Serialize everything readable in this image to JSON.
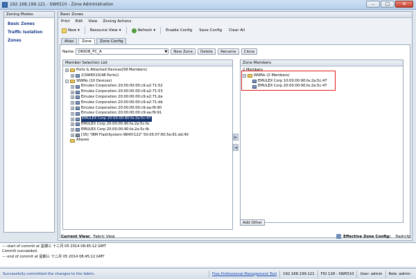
{
  "window": {
    "title": "192.168.199.121 - SW6510 - Zone Administration",
    "min_label": "–",
    "max_label": "□",
    "close_label": "✕"
  },
  "left": {
    "header": "Zoning Modes",
    "items": [
      {
        "label": "Basic Zones"
      },
      {
        "label": "Traffic Isolation Zones"
      }
    ]
  },
  "main": {
    "header": "Basic Zones",
    "menu": [
      "Print",
      "Edit",
      "View",
      "Zoning Actions"
    ],
    "toolbar": {
      "new": "New",
      "resource_view": "Resource View",
      "refresh": "Refresh",
      "enable_config": "Enable Config",
      "save_config": "Save Config",
      "clear_all": "Clear All"
    },
    "tabs": [
      "Alias",
      "Zone",
      "Zone Config"
    ],
    "name_label": "Name",
    "name_value": "ORION_FC_A",
    "buttons": {
      "new_zone": "New Zone",
      "delete": "Delete",
      "rename": "Rename",
      "clone": "Clone"
    }
  },
  "member_list": {
    "header": "Member Selection List",
    "ports_root": "Ports & Attached Devices(58 Members)",
    "ports_child": "2(SW6510(48 Ports))",
    "wwns_root": "WWNs (10 Devices)",
    "items": [
      "Emulex Corporation 20:00:00:00:c9:a2:71:52",
      "Emulex Corporation 20:00:00:00:c9:a2:71:53",
      "Emulex Corporation 20:00:00:00:c9:a2:71:da",
      "Emulex Corporation 20:00:00:00:c9:a2:71:db",
      "Emulex Corporation 20:00:00:00:c9:aa:f9:90",
      "Emulex Corporation 20:00:00:00:c9:aa:f9:91",
      "EMULEX Corp 20:00:00:90:fa:2a:5c:47",
      "EMULEX Corp 20:00:00:90:fa:2a:5c:fa",
      "EMULEX Corp 20:00:00:90:fa:2a:5c:fb",
      "[35] \"IBM     FlashSystem-9840!122\" 50:05:07:60:5e:81:dd:40"
    ],
    "aliases": "Aliases"
  },
  "zone_members": {
    "header": "Zone Members",
    "count": "2 Members",
    "root": "WWNs (2 Members)",
    "items": [
      "EMULEX Corp 10:00:00:90:fa:2a:5c:47",
      "EMULEX Corp 20:00:00:90:fa:2a:5c:47"
    ],
    "add_other": "Add Other"
  },
  "arrows": {
    "add": "▶",
    "remove": "◀"
  },
  "bottom_status": {
    "current_view_label": "Current View:",
    "current_view_value": "Fabric View",
    "effective_label": "Effective Zone Config:",
    "effective_value": "flashcfg"
  },
  "log": [
    "--- start of commit at 星期三 十二月 05 2014 08:45:12 GMT",
    "Commit succeeded.",
    "--- end of commit at 星期三 十二月 05 2014 08:45:12 GMT"
  ],
  "statusbar": {
    "message": "Successfully committed the changes to the fabric.",
    "free_tool": "Free Professional Management Tool",
    "ip": "192.168.199.121",
    "fid": "FID 128 - SW6510",
    "user": "User: admin",
    "role": "Role: admin"
  }
}
